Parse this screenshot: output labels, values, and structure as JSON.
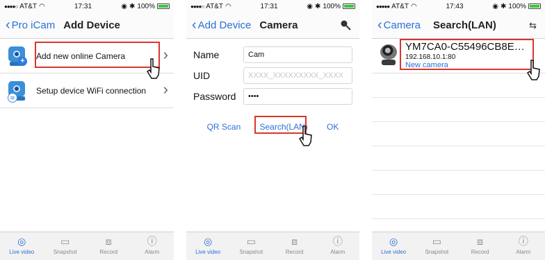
{
  "colors": {
    "accent": "#2b6fd6",
    "highlight": "#d9352b"
  },
  "status_bar": {
    "carrier": "AT&T",
    "battery": "100%",
    "time_1": "17:31",
    "time_2": "17:31",
    "time_3": "17:43"
  },
  "screen1": {
    "back_label": "Pro iCam",
    "title": "Add Device",
    "items": [
      {
        "label": "Add new online Camera",
        "icon": "camera-add-icon"
      },
      {
        "label": "Setup device WiFi connection",
        "icon": "camera-wifi-icon"
      }
    ]
  },
  "screen2": {
    "back_label": "Add Device",
    "title": "Camera",
    "right_icon": "search-icon",
    "fields": {
      "name_label": "Name",
      "name_value": "Cam",
      "uid_label": "UID",
      "uid_placeholder": "XXXX_XXXXXXXXX_XXXX",
      "password_label": "Password",
      "password_value": "••••"
    },
    "actions": {
      "qr_scan": "QR Scan",
      "search_lan": "Search(LAN)",
      "ok": "OK"
    }
  },
  "screen3": {
    "back_label": "Camera",
    "title": "Search(LAN)",
    "right_icon": "refresh-icon",
    "devices": [
      {
        "name": "YM7CA0-C55496CB8E…",
        "address": "192.168.10.1:80",
        "status": "New camera"
      }
    ]
  },
  "tabbar": {
    "items": [
      {
        "label": "Live video",
        "icon": "live-video-icon",
        "active": true
      },
      {
        "label": "Snapshot",
        "icon": "snapshot-icon",
        "active": false
      },
      {
        "label": "Record",
        "icon": "record-icon",
        "active": false
      },
      {
        "label": "Alarm",
        "icon": "alarm-icon",
        "active": false
      }
    ]
  }
}
